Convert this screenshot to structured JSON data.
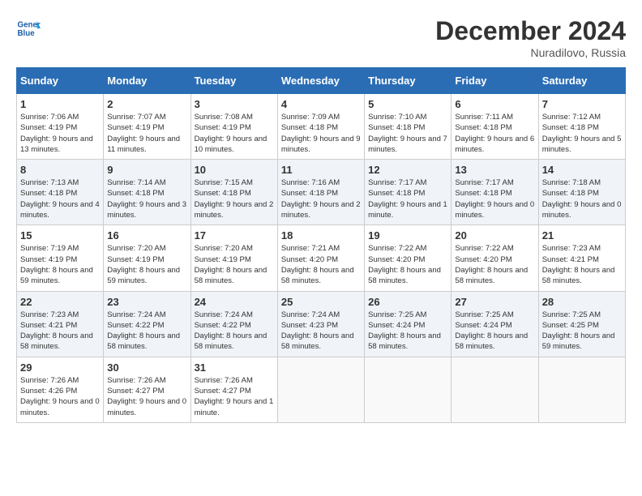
{
  "header": {
    "logo_line1": "General",
    "logo_line2": "Blue",
    "month_title": "December 2024",
    "location": "Nuradilovo, Russia"
  },
  "days_of_week": [
    "Sunday",
    "Monday",
    "Tuesday",
    "Wednesday",
    "Thursday",
    "Friday",
    "Saturday"
  ],
  "weeks": [
    [
      {
        "day": 1,
        "sunrise": "7:06 AM",
        "sunset": "4:19 PM",
        "daylight": "9 hours and 13 minutes."
      },
      {
        "day": 2,
        "sunrise": "7:07 AM",
        "sunset": "4:19 PM",
        "daylight": "9 hours and 11 minutes."
      },
      {
        "day": 3,
        "sunrise": "7:08 AM",
        "sunset": "4:19 PM",
        "daylight": "9 hours and 10 minutes."
      },
      {
        "day": 4,
        "sunrise": "7:09 AM",
        "sunset": "4:18 PM",
        "daylight": "9 hours and 9 minutes."
      },
      {
        "day": 5,
        "sunrise": "7:10 AM",
        "sunset": "4:18 PM",
        "daylight": "9 hours and 7 minutes."
      },
      {
        "day": 6,
        "sunrise": "7:11 AM",
        "sunset": "4:18 PM",
        "daylight": "9 hours and 6 minutes."
      },
      {
        "day": 7,
        "sunrise": "7:12 AM",
        "sunset": "4:18 PM",
        "daylight": "9 hours and 5 minutes."
      }
    ],
    [
      {
        "day": 8,
        "sunrise": "7:13 AM",
        "sunset": "4:18 PM",
        "daylight": "9 hours and 4 minutes."
      },
      {
        "day": 9,
        "sunrise": "7:14 AM",
        "sunset": "4:18 PM",
        "daylight": "9 hours and 3 minutes."
      },
      {
        "day": 10,
        "sunrise": "7:15 AM",
        "sunset": "4:18 PM",
        "daylight": "9 hours and 2 minutes."
      },
      {
        "day": 11,
        "sunrise": "7:16 AM",
        "sunset": "4:18 PM",
        "daylight": "9 hours and 2 minutes."
      },
      {
        "day": 12,
        "sunrise": "7:17 AM",
        "sunset": "4:18 PM",
        "daylight": "9 hours and 1 minute."
      },
      {
        "day": 13,
        "sunrise": "7:17 AM",
        "sunset": "4:18 PM",
        "daylight": "9 hours and 0 minutes."
      },
      {
        "day": 14,
        "sunrise": "7:18 AM",
        "sunset": "4:18 PM",
        "daylight": "9 hours and 0 minutes."
      }
    ],
    [
      {
        "day": 15,
        "sunrise": "7:19 AM",
        "sunset": "4:19 PM",
        "daylight": "8 hours and 59 minutes."
      },
      {
        "day": 16,
        "sunrise": "7:20 AM",
        "sunset": "4:19 PM",
        "daylight": "8 hours and 59 minutes."
      },
      {
        "day": 17,
        "sunrise": "7:20 AM",
        "sunset": "4:19 PM",
        "daylight": "8 hours and 58 minutes."
      },
      {
        "day": 18,
        "sunrise": "7:21 AM",
        "sunset": "4:20 PM",
        "daylight": "8 hours and 58 minutes."
      },
      {
        "day": 19,
        "sunrise": "7:22 AM",
        "sunset": "4:20 PM",
        "daylight": "8 hours and 58 minutes."
      },
      {
        "day": 20,
        "sunrise": "7:22 AM",
        "sunset": "4:20 PM",
        "daylight": "8 hours and 58 minutes."
      },
      {
        "day": 21,
        "sunrise": "7:23 AM",
        "sunset": "4:21 PM",
        "daylight": "8 hours and 58 minutes."
      }
    ],
    [
      {
        "day": 22,
        "sunrise": "7:23 AM",
        "sunset": "4:21 PM",
        "daylight": "8 hours and 58 minutes."
      },
      {
        "day": 23,
        "sunrise": "7:24 AM",
        "sunset": "4:22 PM",
        "daylight": "8 hours and 58 minutes."
      },
      {
        "day": 24,
        "sunrise": "7:24 AM",
        "sunset": "4:22 PM",
        "daylight": "8 hours and 58 minutes."
      },
      {
        "day": 25,
        "sunrise": "7:24 AM",
        "sunset": "4:23 PM",
        "daylight": "8 hours and 58 minutes."
      },
      {
        "day": 26,
        "sunrise": "7:25 AM",
        "sunset": "4:24 PM",
        "daylight": "8 hours and 58 minutes."
      },
      {
        "day": 27,
        "sunrise": "7:25 AM",
        "sunset": "4:24 PM",
        "daylight": "8 hours and 58 minutes."
      },
      {
        "day": 28,
        "sunrise": "7:25 AM",
        "sunset": "4:25 PM",
        "daylight": "8 hours and 59 minutes."
      }
    ],
    [
      {
        "day": 29,
        "sunrise": "7:26 AM",
        "sunset": "4:26 PM",
        "daylight": "9 hours and 0 minutes."
      },
      {
        "day": 30,
        "sunrise": "7:26 AM",
        "sunset": "4:27 PM",
        "daylight": "9 hours and 0 minutes."
      },
      {
        "day": 31,
        "sunrise": "7:26 AM",
        "sunset": "4:27 PM",
        "daylight": "9 hours and 1 minute."
      },
      null,
      null,
      null,
      null
    ]
  ]
}
